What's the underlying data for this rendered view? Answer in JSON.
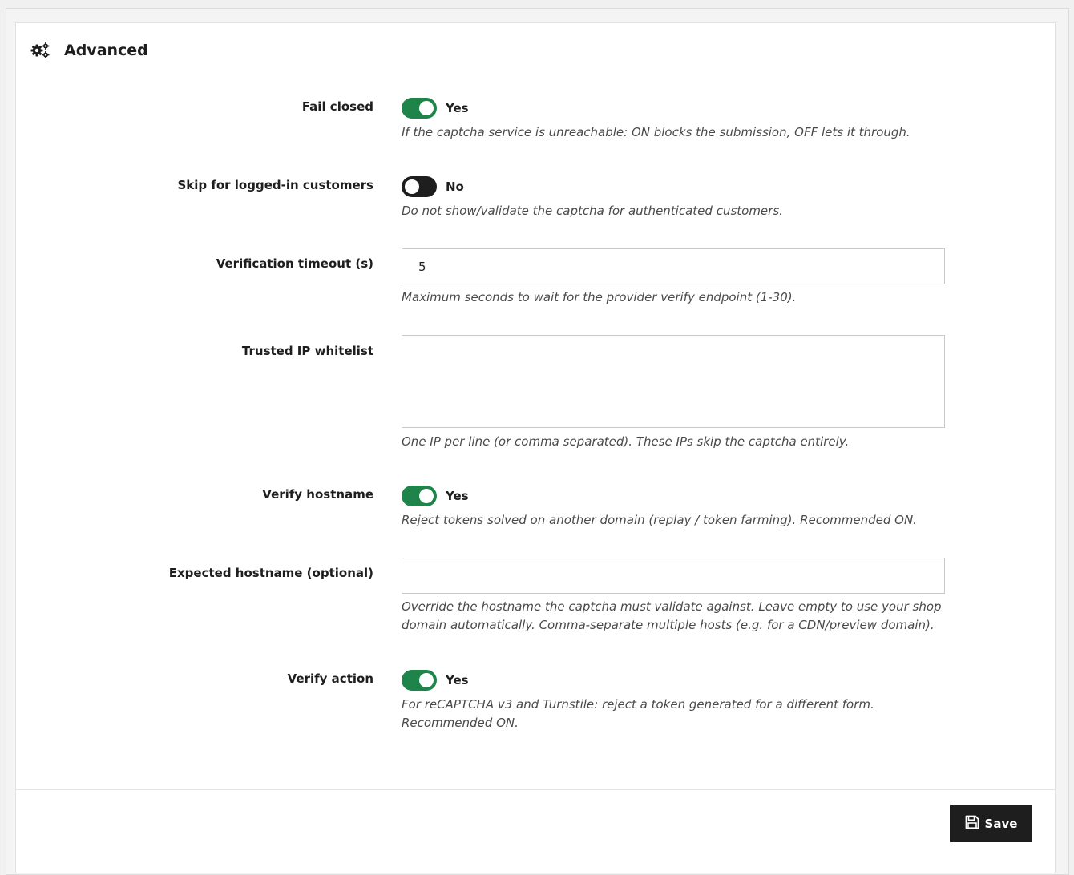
{
  "section": {
    "title": "Advanced",
    "icon": "cogs-icon"
  },
  "fields": {
    "fail_closed": {
      "label": "Fail closed",
      "state": "Yes",
      "on": true,
      "help": "If the captcha service is unreachable: ON blocks the submission, OFF lets it through."
    },
    "skip_logged_in": {
      "label": "Skip for logged-in customers",
      "state": "No",
      "on": false,
      "help": "Do not show/validate the captcha for authenticated customers."
    },
    "verification_timeout": {
      "label": "Verification timeout (s)",
      "value": "5",
      "help": "Maximum seconds to wait for the provider verify endpoint (1-30)."
    },
    "trusted_ip_whitelist": {
      "label": "Trusted IP whitelist",
      "value": "",
      "help": "One IP per line (or comma separated). These IPs skip the captcha entirely."
    },
    "verify_hostname": {
      "label": "Verify hostname",
      "state": "Yes",
      "on": true,
      "help": "Reject tokens solved on another domain (replay / token farming). Recommended ON."
    },
    "expected_hostname": {
      "label": "Expected hostname (optional)",
      "value": "",
      "help": "Override the hostname the captcha must validate against. Leave empty to use your shop domain automatically. Comma-separate multiple hosts (e.g. for a CDN/preview domain)."
    },
    "verify_action": {
      "label": "Verify action",
      "state": "Yes",
      "on": true,
      "help": "For reCAPTCHA v3 and Turnstile: reject a token generated for a different form. Recommended ON."
    }
  },
  "footer": {
    "save_label": "Save",
    "save_icon": "save-icon"
  },
  "colors": {
    "toggle_on": "#1e8449",
    "toggle_off": "#1e1e1e",
    "button": "#1e1e1e"
  }
}
